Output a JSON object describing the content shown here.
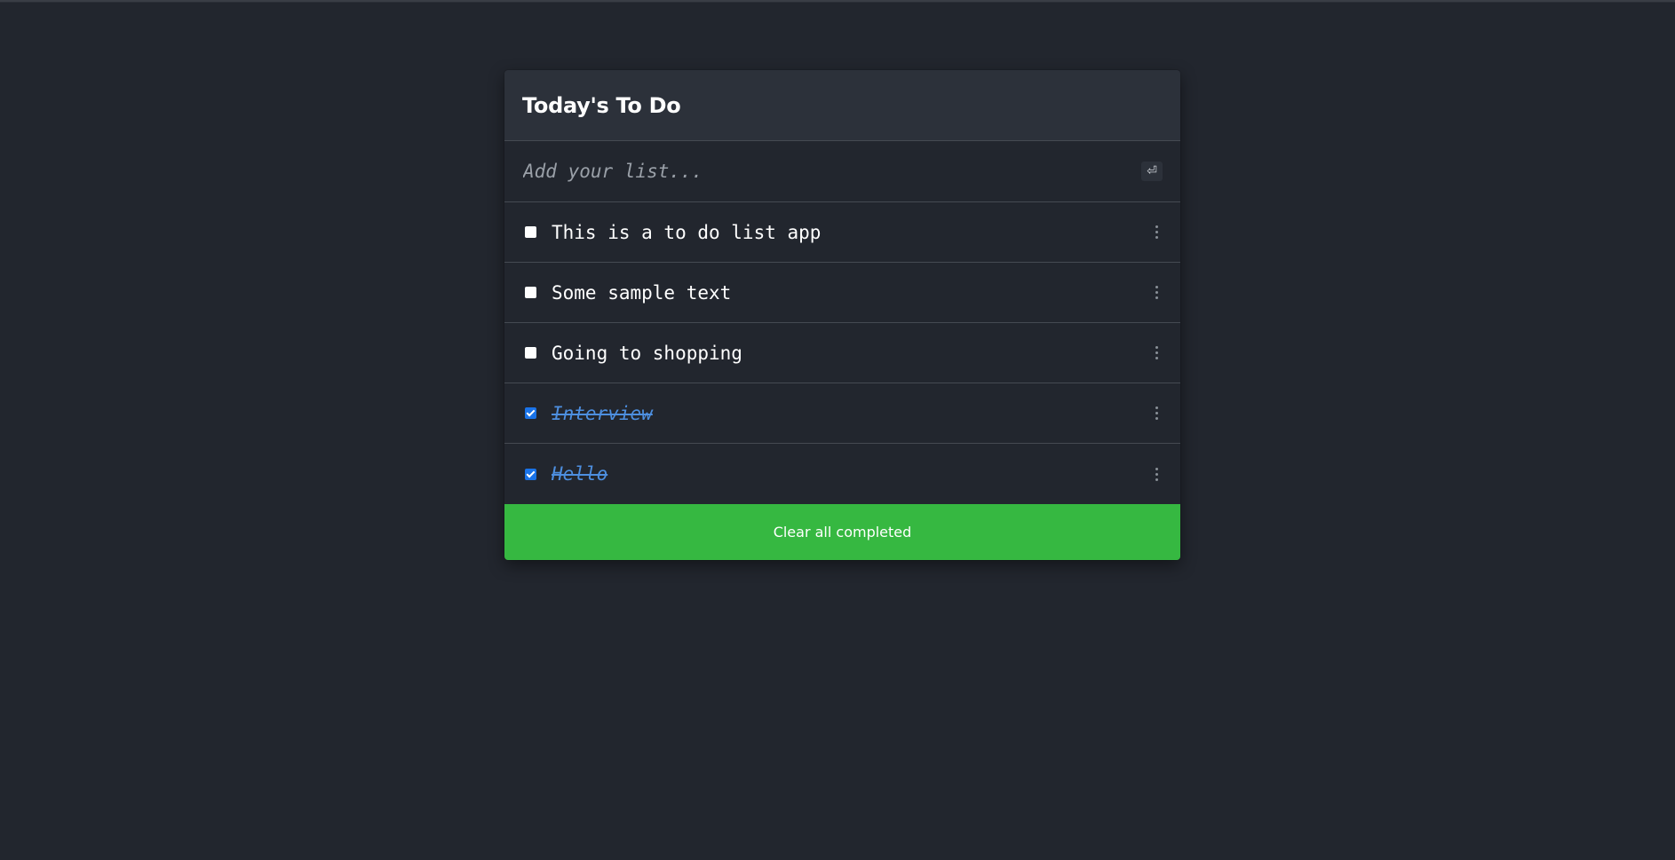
{
  "app": {
    "title": "Today's To Do"
  },
  "input": {
    "placeholder": "Add your list...",
    "value": "",
    "submit_icon": "enter-icon",
    "submit_glyph": "⏎"
  },
  "todos": [
    {
      "text": "This is a to do list app",
      "completed": false
    },
    {
      "text": "Some sample text",
      "completed": false
    },
    {
      "text": "Going to shopping",
      "completed": false
    },
    {
      "text": "Interview",
      "completed": true
    },
    {
      "text": "Hello",
      "completed": true
    }
  ],
  "footer": {
    "clear_label": "Clear all completed"
  },
  "colors": {
    "background": "#22262e",
    "header": "#2c313a",
    "accent_green": "#36b841",
    "completed_text": "#4d8fe0",
    "checkbox_checked": "#1a73e8"
  }
}
